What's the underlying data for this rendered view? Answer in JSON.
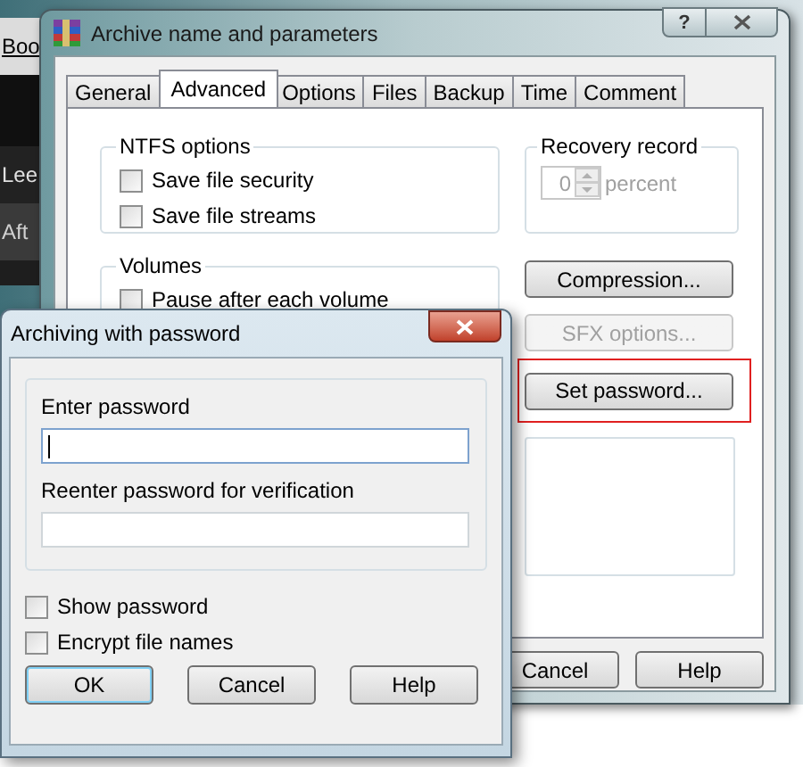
{
  "background_window": {
    "texts": [
      "Boo",
      "Lee",
      "Aft"
    ]
  },
  "main_dialog": {
    "title": "Archive name and parameters",
    "help_glyph": "?",
    "tabs": [
      {
        "label": "General",
        "selected": false
      },
      {
        "label": "Advanced",
        "selected": true
      },
      {
        "label": "Options",
        "selected": false
      },
      {
        "label": "Files",
        "selected": false
      },
      {
        "label": "Backup",
        "selected": false
      },
      {
        "label": "Time",
        "selected": false
      },
      {
        "label": "Comment",
        "selected": false
      }
    ],
    "ntfs": {
      "title": "NTFS options",
      "options": [
        {
          "label": "Save file security",
          "checked": false
        },
        {
          "label": "Save file streams",
          "checked": false
        }
      ]
    },
    "recovery": {
      "title": "Recovery record",
      "value": "0",
      "unit": "percent",
      "disabled": true
    },
    "volumes": {
      "title": "Volumes",
      "options": [
        {
          "label": "Pause after each volume",
          "checked": false
        }
      ]
    },
    "buttons": [
      {
        "label": "Compression...",
        "disabled": false,
        "highlighted": false
      },
      {
        "label": "SFX options...",
        "disabled": true,
        "highlighted": false
      },
      {
        "label": "Set password...",
        "disabled": false,
        "highlighted": true
      }
    ],
    "footer_buttons": [
      "Cancel",
      "Help"
    ]
  },
  "password_dialog": {
    "title": "Archiving with password",
    "fields": [
      {
        "label": "Enter password",
        "focused": true
      },
      {
        "label": "Reenter password for verification",
        "focused": false
      }
    ],
    "options": [
      {
        "label": "Show password",
        "checked": false
      },
      {
        "label": "Encrypt file names",
        "checked": false
      }
    ],
    "buttons": [
      {
        "label": "OK",
        "default": true
      },
      {
        "label": "Cancel",
        "default": false
      },
      {
        "label": "Help",
        "default": false
      }
    ]
  }
}
